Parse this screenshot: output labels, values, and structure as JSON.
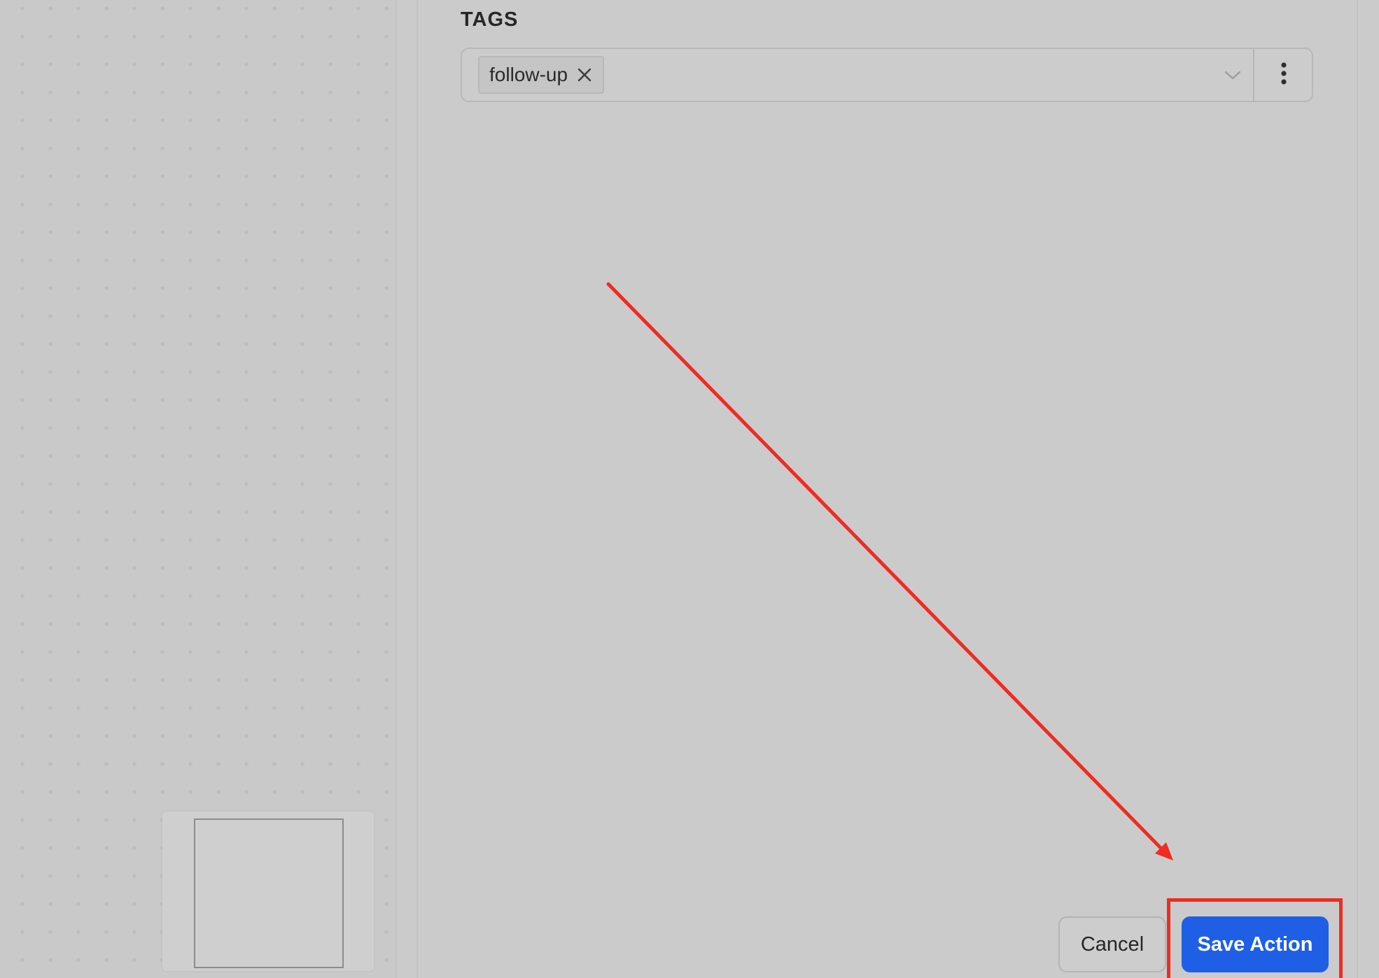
{
  "tags_section": {
    "label": "TAGS",
    "chips": [
      {
        "label": "follow-up"
      }
    ]
  },
  "footer": {
    "cancel_label": "Cancel",
    "save_label": "Save Action"
  },
  "colors": {
    "primary": "#1f5fe6",
    "annotation": "#ef2b22",
    "background": "#cbcbcb"
  },
  "icons": {
    "tag_remove": "close-icon",
    "dropdown": "chevron-down-icon",
    "more": "more-vertical-icon"
  }
}
